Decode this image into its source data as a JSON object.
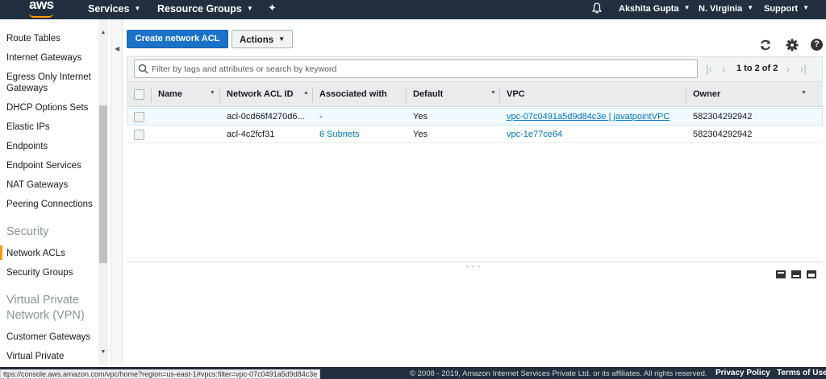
{
  "topnav": {
    "logo": "aws",
    "services": "Services",
    "resource_groups": "Resource Groups",
    "user": "Akshita Gupta",
    "region": "N. Virginia",
    "support": "Support"
  },
  "sidebar": {
    "items": [
      "Route Tables",
      "Internet Gateways",
      "Egress Only Internet",
      "Gateways",
      "DHCP Options Sets",
      "Elastic IPs",
      "Endpoints",
      "Endpoint Services",
      "NAT Gateways",
      "Peering Connections"
    ],
    "security_heading": "Security",
    "security_items": [
      "Network ACLs",
      "Security Groups"
    ],
    "vpn_heading_1": "Virtual Private",
    "vpn_heading_2": "Network (VPN)",
    "vpn_items": [
      "Customer Gateways",
      "Virtual Private"
    ],
    "active_item": "Network ACLs"
  },
  "toolbar": {
    "create_label": "Create network ACL",
    "actions_label": "Actions"
  },
  "search": {
    "placeholder": "Filter by tags and attributes or search by keyword"
  },
  "pagination": {
    "text": "1 to 2 of 2"
  },
  "table": {
    "columns": [
      "Name",
      "Network ACL ID",
      "Associated with",
      "Default",
      "VPC",
      "Owner"
    ],
    "rows": [
      {
        "name": "",
        "acl_id": "acl-0cd66f4270d6...",
        "associated": "-",
        "default": "Yes",
        "vpc": "vpc-07c0491a5d9d84c3e | javatpointVPC",
        "owner": "582304292942"
      },
      {
        "name": "",
        "acl_id": "acl-4c2fcf31",
        "associated": "6 Subnets",
        "default": "Yes",
        "vpc": "vpc-1e77ce64",
        "owner": "582304292942"
      }
    ]
  },
  "footer": {
    "status_url": "ttps://console.aws.amazon.com/vpc/home?region=us-east-1#vpcs:filter=vpc-07c0491a5d9d84c3e",
    "copyright": "© 2008 - 2019, Amazon Internet Services Private Ltd. or its affiliates. All rights reserved.",
    "privacy": "Privacy Policy",
    "terms": "Terms of Use"
  },
  "colors": {
    "nav_bg": "#232f3e",
    "primary_button": "#1a73c9",
    "link": "#0073bb",
    "active_marker": "#ff9900"
  }
}
